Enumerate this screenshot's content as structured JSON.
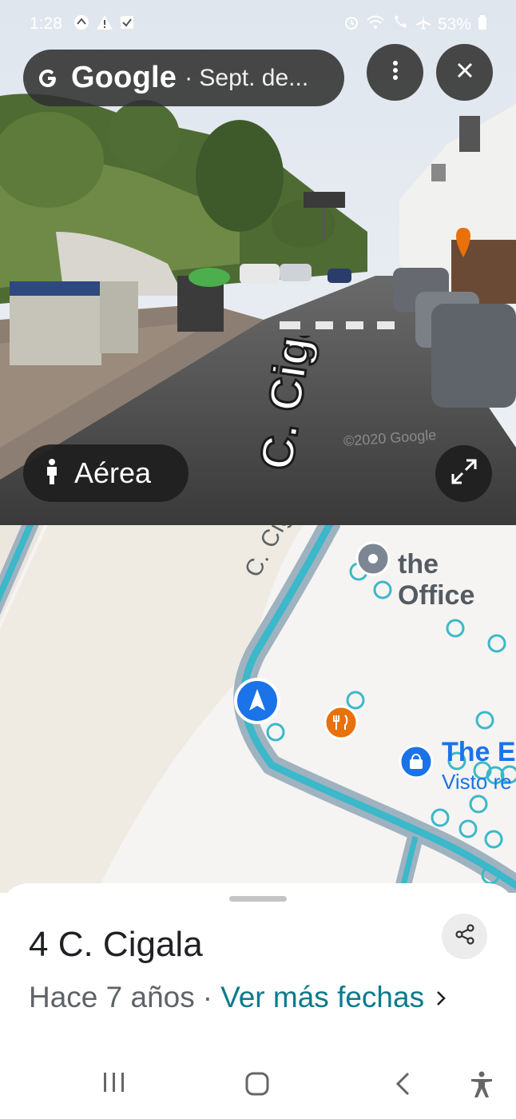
{
  "status_bar": {
    "time": "1:28",
    "battery": "53%"
  },
  "street_view": {
    "brand": "Google",
    "date_label": "· Sept. de...",
    "aerial_label": "Aérea",
    "street_text": "C. Cigala",
    "copyright": "©2020 Google"
  },
  "map": {
    "street_name": "C. Cigala",
    "poi_office": "the Office",
    "poi_store": "The E",
    "poi_store_sub": "Visto re"
  },
  "sheet": {
    "title": "4 C. Cigala",
    "ago": "Hace 7 años",
    "separator": "·",
    "more_dates": "Ver más fechas"
  },
  "colors": {
    "route": "#3bb8c9",
    "route_casing": "#9fb2c0",
    "link": "#0b7a8c",
    "nav_blue": "#1a73e8"
  },
  "icons": {
    "status": [
      "sync-icon",
      "warning-icon",
      "checkbox-icon",
      "alarm-icon",
      "wifi-icon",
      "wifi-call-icon",
      "airplane-icon",
      "battery-icon"
    ],
    "street_view": [
      "google-g-icon",
      "more-vert-icon",
      "close-icon",
      "person-icon",
      "expand-icon"
    ],
    "sheet": [
      "share-icon",
      "chevron-right-icon"
    ],
    "nav": [
      "recents-icon",
      "home-icon",
      "back-icon",
      "accessibility-icon"
    ]
  }
}
